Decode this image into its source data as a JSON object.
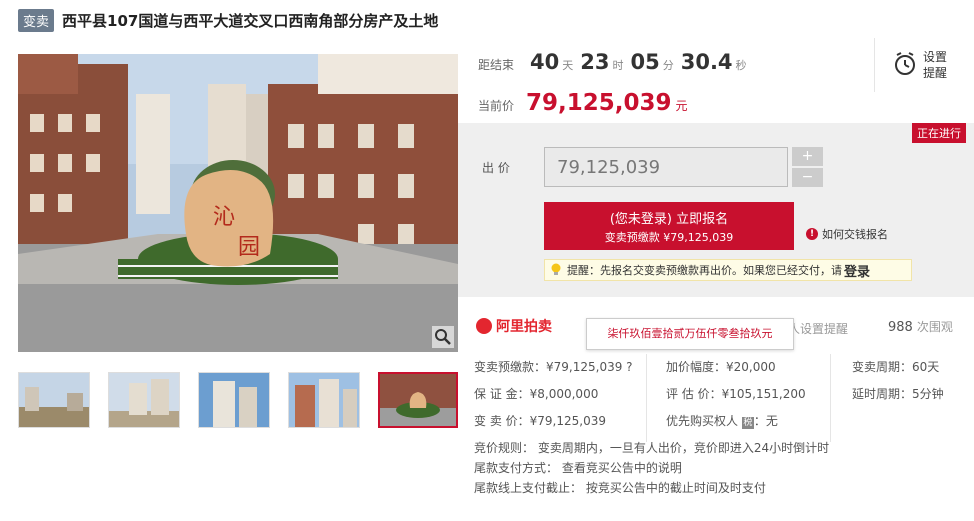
{
  "header": {
    "tag": "变卖",
    "title": "西平县107国道与西平大道交叉口西南角部分房产及土地"
  },
  "countdown": {
    "label": "距结束",
    "days": "40",
    "days_unit": "天",
    "hours": "23",
    "hours_unit": "时",
    "minutes": "05",
    "minutes_unit": "分",
    "seconds": "30.4",
    "seconds_unit": "秒"
  },
  "price": {
    "label": "当前价",
    "value": "79,125,039",
    "unit": "元"
  },
  "remind": {
    "label": "设置\n提醒",
    "line1": "设置",
    "line2": "提醒",
    "icon": "alarm-clock-icon"
  },
  "status": {
    "badge": "正在进行"
  },
  "bid": {
    "label": "出 价",
    "input_value": "79,125,039",
    "plus": "+",
    "minus": "−",
    "signup_main": "(您未登录) 立即报名",
    "signup_sub": "变卖预缴款 ¥79,125,039",
    "howpay": "如何交钱报名",
    "tip_prefix": "提醒：先报名交变卖预缴款再出价。如果您已经交付，请",
    "tip_link": "登录"
  },
  "platform": {
    "logo": "阿里拍卖",
    "reminder_set": "人设置提醒",
    "views": "988",
    "views_unit": "次围观",
    "tooltip": "柒仟玖佰壹拾贰万伍仟零叁拾玖元"
  },
  "details": {
    "deposit": "变卖预缴款：¥79,125,039",
    "increment": "加价幅度：¥20,000",
    "period": "变卖周期：60天",
    "guarantee": "保 证 金：¥8,000,000",
    "appraisal": "评 估 价：¥105,151,200",
    "extension": "延时周期：5分钟",
    "sale_price": "变 卖 价：¥79,125,039",
    "priority": "优先购买权人",
    "priority_value": "：无"
  },
  "rules": {
    "r1": "竞价规则： 变卖周期内，一旦有人出价，竞价即进入24小时倒计时",
    "r2": "尾款支付方式： 查看竞买公告中的说明",
    "r3": "尾款线上支付截止： 按竞买公告中的截止时间及时支付"
  }
}
